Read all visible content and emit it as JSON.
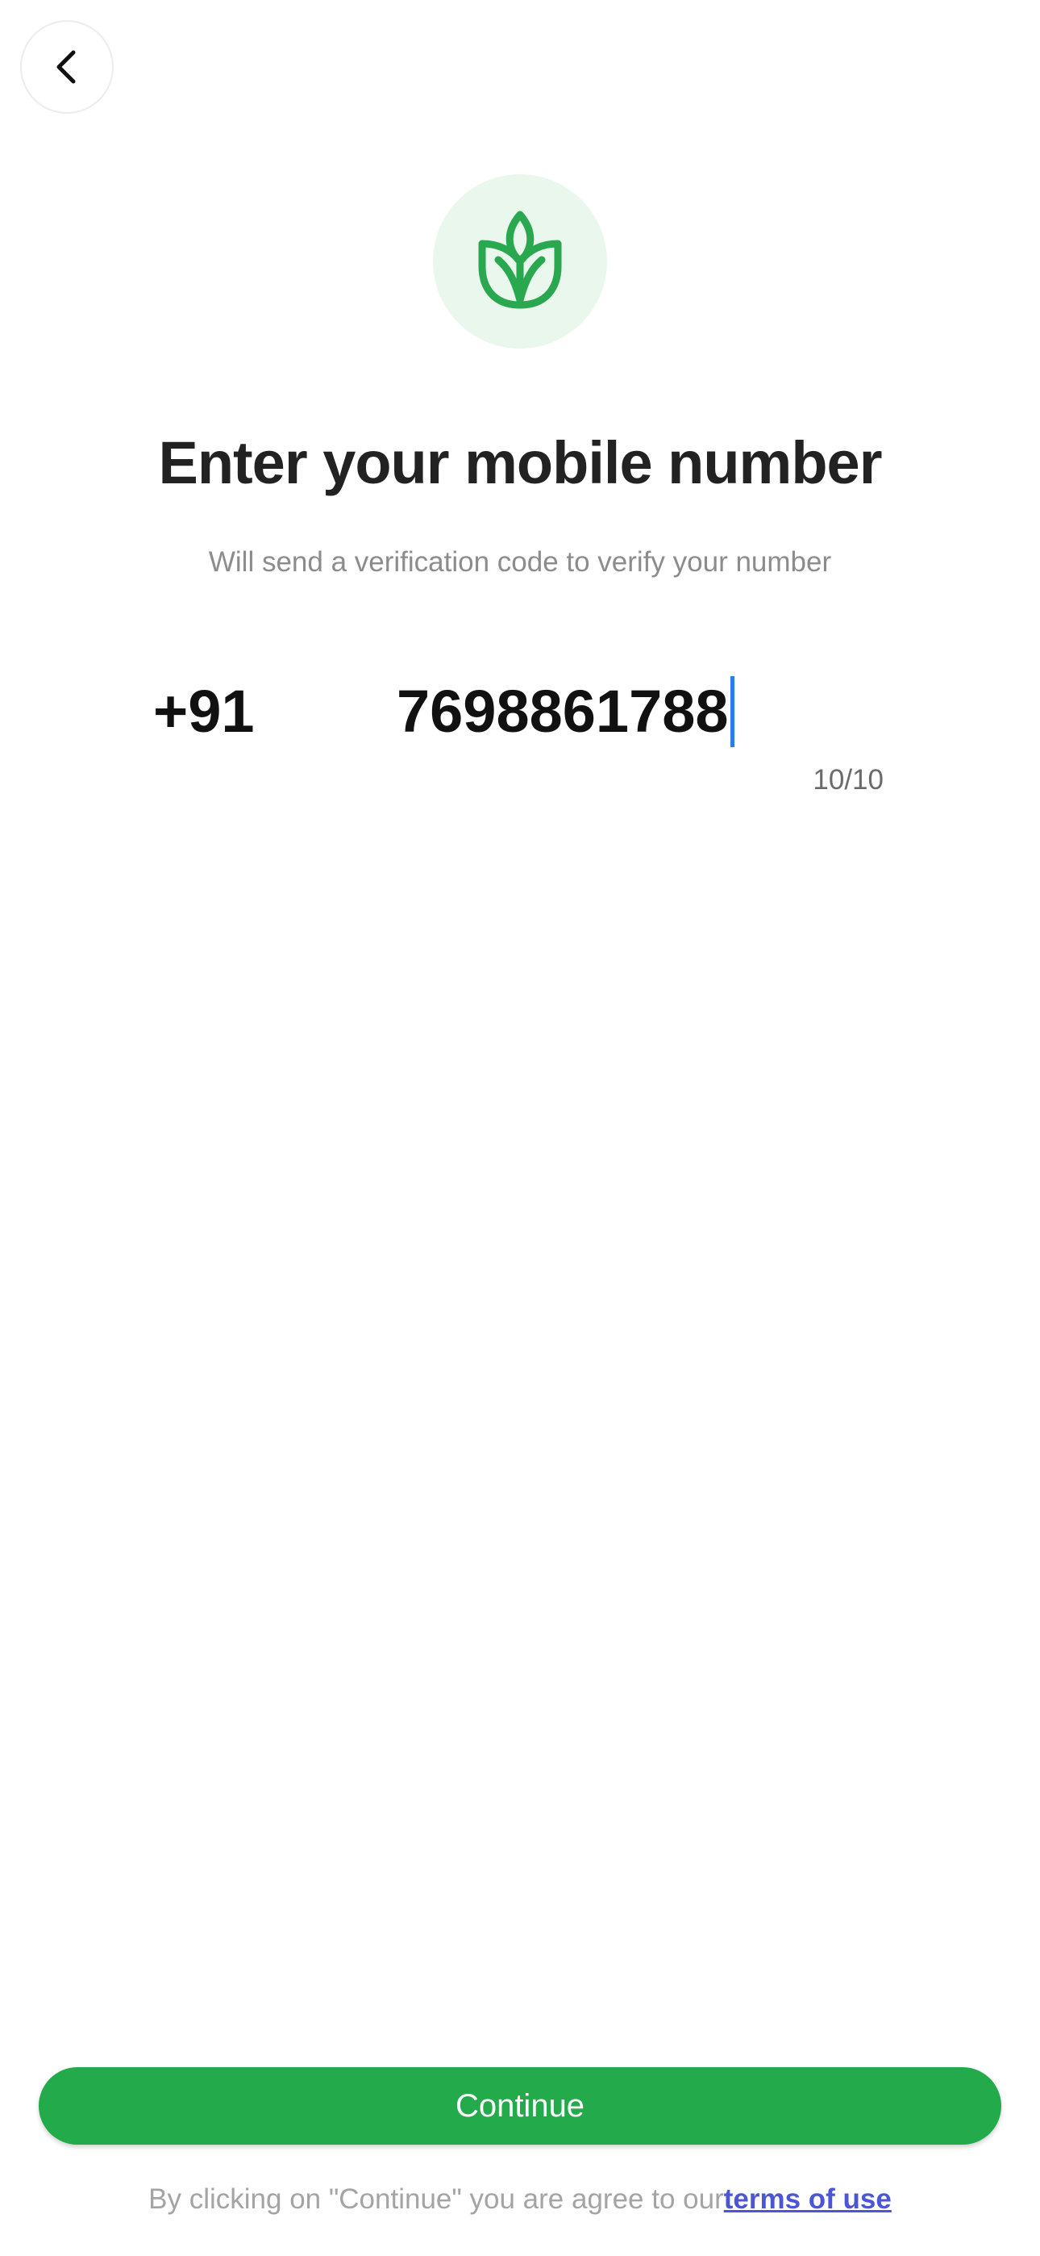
{
  "header": {
    "back_icon": "chevron-left-icon"
  },
  "logo": {
    "icon": "sprout-leaf-icon",
    "circle_color": "#e9f7ec",
    "icon_color": "#2aa850"
  },
  "content": {
    "title": "Enter your mobile number",
    "subtitle": "Will send a verification code to verify your number"
  },
  "phone": {
    "country_code": "+91",
    "number": "7698861788",
    "counter": "10/10",
    "caret_color": "#2b7de9"
  },
  "footer": {
    "continue_label": "Continue",
    "continue_color": "#23aa4a",
    "terms_prefix": "By clicking on \"Continue\" you are agree to our",
    "terms_link": "terms of use",
    "link_color": "#4c55d6"
  }
}
